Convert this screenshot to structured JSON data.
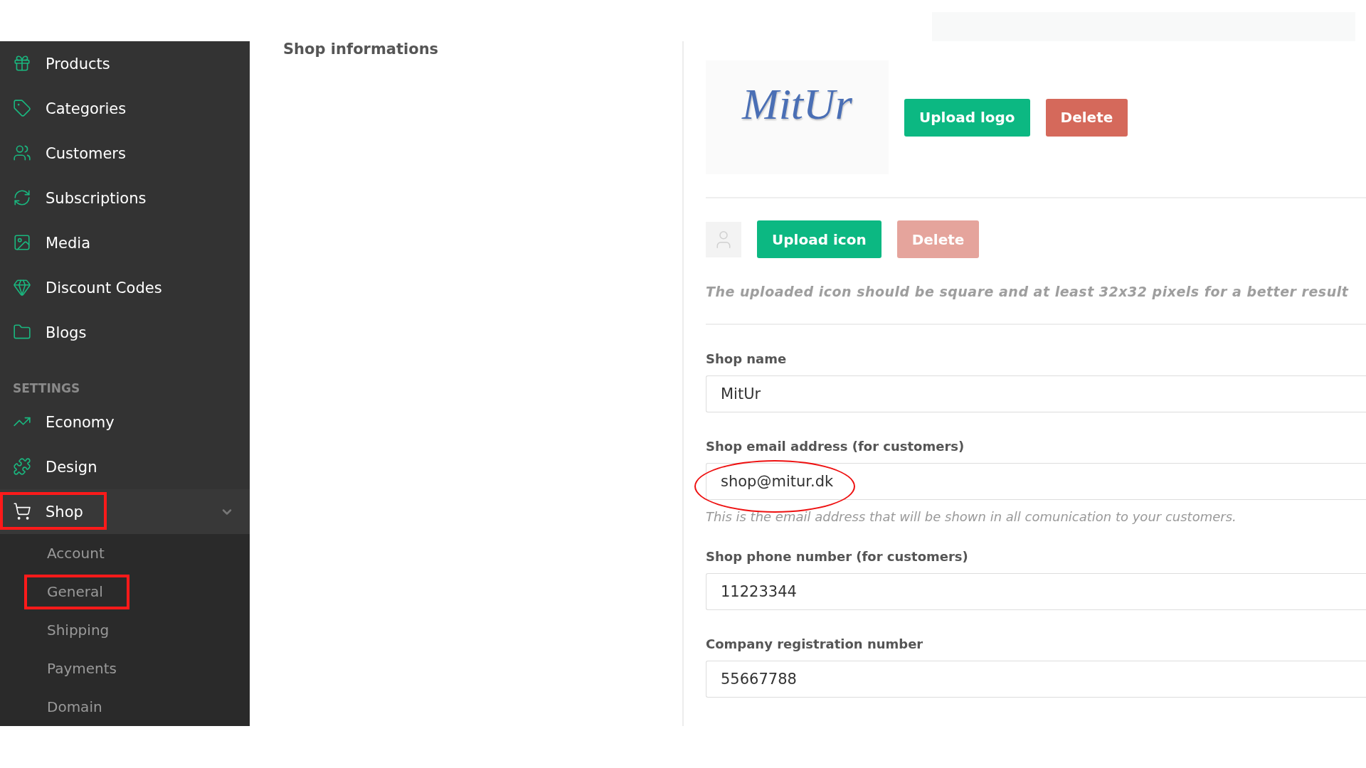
{
  "sidebar": {
    "items": [
      {
        "label": "Products",
        "selected": false
      },
      {
        "label": "Categories",
        "selected": false
      },
      {
        "label": "Customers",
        "selected": false
      },
      {
        "label": "Subscriptions",
        "selected": false
      },
      {
        "label": "Media",
        "selected": false
      },
      {
        "label": "Discount Codes",
        "selected": false
      },
      {
        "label": "Blogs",
        "selected": false
      }
    ],
    "settings_heading": "SETTINGS",
    "settings_items": [
      {
        "label": "Economy",
        "annotated": false
      },
      {
        "label": "Design",
        "annotated": false
      },
      {
        "label": "Shop",
        "expanded": true,
        "annotated": true,
        "children": [
          {
            "label": "Account",
            "annotated": false
          },
          {
            "label": "General",
            "annotated": true
          },
          {
            "label": "Shipping",
            "annotated": false
          },
          {
            "label": "Payments",
            "annotated": false
          },
          {
            "label": "Domain",
            "annotated": false
          }
        ]
      }
    ]
  },
  "section_title": "Shop informations",
  "logo": {
    "text": "MitUr",
    "buttons": [
      {
        "label": "Upload logo",
        "kind": "primary",
        "disabled": false
      },
      {
        "label": "Delete",
        "kind": "danger",
        "disabled": false
      }
    ]
  },
  "icon": {
    "buttons": [
      {
        "label": "Upload icon",
        "kind": "primary",
        "disabled": false
      },
      {
        "label": "Delete",
        "kind": "danger",
        "disabled": true
      }
    ],
    "hint": "The uploaded icon should be square and at least 32x32 pixels for a better result"
  },
  "fields": [
    {
      "label": "Shop name",
      "value": "MitUr"
    },
    {
      "label": "Shop email address (for customers)",
      "value": "shop@mitur.dk",
      "annotated": true,
      "help": "This is the email address that will be shown in all comunication to your customers."
    },
    {
      "label": "Shop phone number (for customers)",
      "value": "11223344"
    },
    {
      "label": "Company registration number",
      "value": "55667788"
    }
  ]
}
